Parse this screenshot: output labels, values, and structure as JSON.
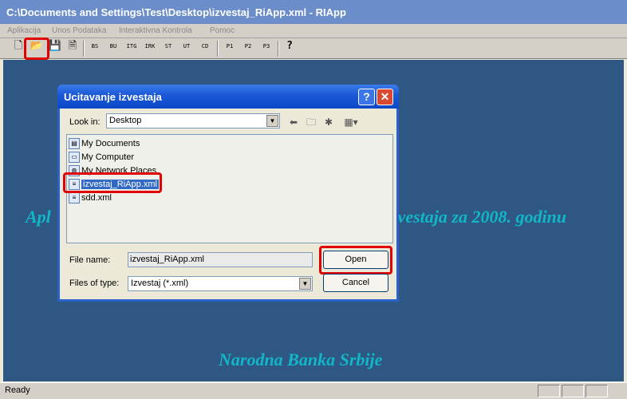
{
  "window": {
    "title": "C:\\Documents and Settings\\Test\\Desktop\\izvestaj_RiApp.xml - RIApp"
  },
  "menu": [
    "Aplikacija",
    "Unos Podataka",
    "Interaktivna Kontrola",
    "Pomoc"
  ],
  "toolbar": {
    "buttons": [
      {
        "name": "new-file-icon",
        "glyph": "🗋"
      },
      {
        "name": "open-folder-icon",
        "glyph": "📂"
      },
      {
        "name": "save-disk-icon",
        "glyph": "💾"
      },
      {
        "name": "document-icon",
        "glyph": "🗎"
      },
      {
        "name": "bs-check-icon",
        "glyph": "BS"
      },
      {
        "name": "bu-check-icon",
        "glyph": "BU"
      },
      {
        "name": "itg-check-icon",
        "glyph": "ITG"
      },
      {
        "name": "irk-check-icon",
        "glyph": "IRK"
      },
      {
        "name": "st-check-icon",
        "glyph": "ST"
      },
      {
        "name": "ut-check-icon",
        "glyph": "UT"
      },
      {
        "name": "cd-check-icon",
        "glyph": "CD"
      },
      {
        "name": "p1-check-icon",
        "glyph": "P1"
      },
      {
        "name": "p2-check-icon",
        "glyph": "P2"
      },
      {
        "name": "p3-check-icon",
        "glyph": "P3"
      },
      {
        "name": "help-question-icon",
        "glyph": "?"
      }
    ]
  },
  "background": {
    "line1_left": "Apl",
    "line1_right": "zvestaja za 2008. godinu",
    "footer": "Narodna Banka Srbije"
  },
  "dialog": {
    "title": "Ucitavanje izvestaja",
    "help_glyph": "?",
    "close_glyph": "✕",
    "look_in_label": "Look in:",
    "look_in_value": "Desktop",
    "files": [
      {
        "name": "My Documents",
        "icon": "my-documents-icon"
      },
      {
        "name": "My Computer",
        "icon": "my-computer-icon"
      },
      {
        "name": "My Network Places",
        "icon": "network-places-icon"
      },
      {
        "name": "izvestaj_RiApp.xml",
        "icon": "xml-file-icon"
      },
      {
        "name": "sdd.xml",
        "icon": "xml-file-icon"
      }
    ],
    "file_name_label": "File name:",
    "file_name_value": "izvestaj_RiApp.xml",
    "files_of_type_label": "Files of type:",
    "files_of_type_value": "Izvestaj (*.xml)",
    "open_label": "Open",
    "cancel_label": "Cancel"
  },
  "status": {
    "text": "Ready"
  }
}
